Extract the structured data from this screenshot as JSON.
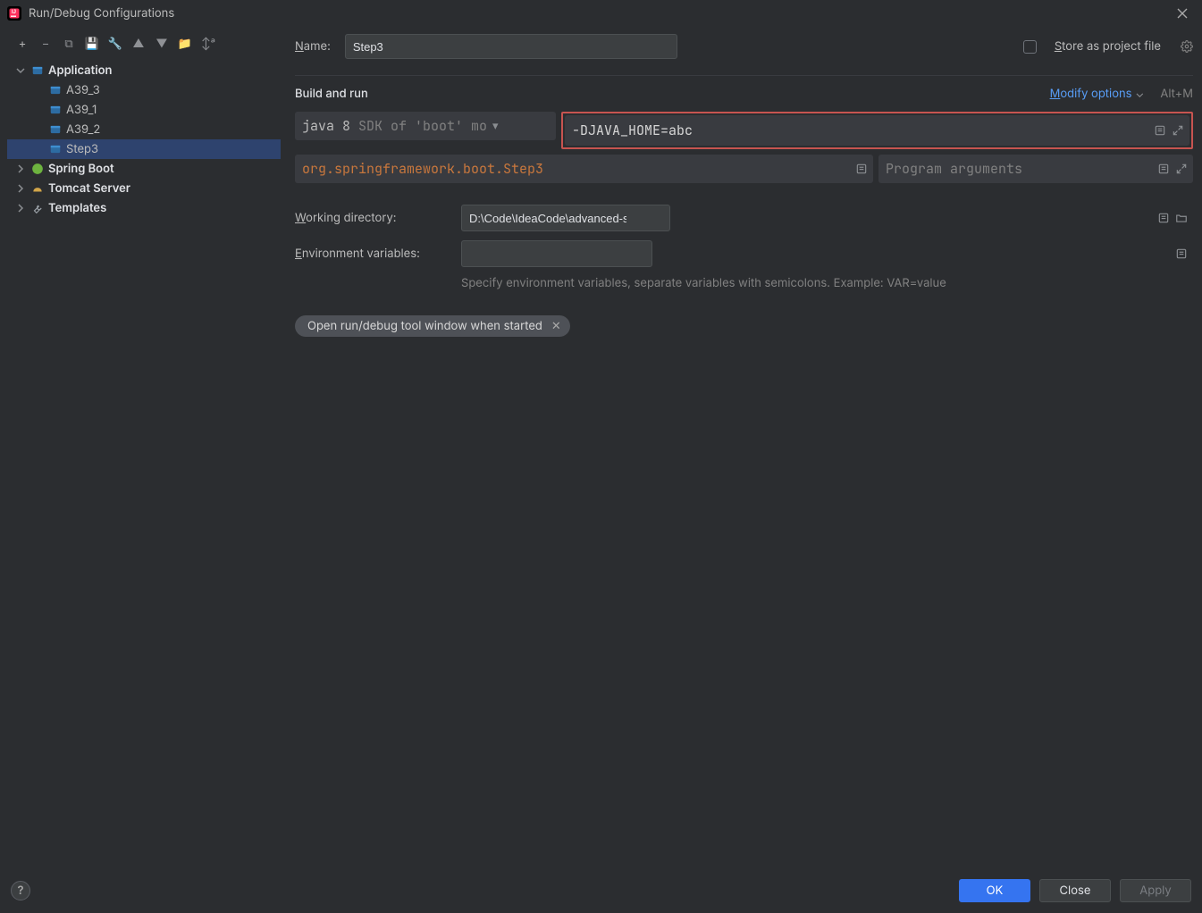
{
  "title": "Run/Debug Configurations",
  "toolbar_icons": [
    {
      "name": "add-icon",
      "glyph": "+"
    },
    {
      "name": "remove-icon",
      "glyph": "−"
    },
    {
      "name": "copy-icon",
      "glyph": "⧉"
    },
    {
      "name": "save-icon",
      "glyph": "💾"
    },
    {
      "name": "wrench-icon",
      "glyph": "🔧"
    },
    {
      "name": "move-up-icon",
      "glyph": "▲"
    },
    {
      "name": "move-down-icon",
      "glyph": "▼"
    },
    {
      "name": "folder-plus-icon",
      "glyph": "📁"
    },
    {
      "name": "sort-alpha-icon",
      "glyph": "↕ᵃ"
    }
  ],
  "tree": [
    {
      "label": "Application",
      "expanded": true,
      "depth": 0,
      "children": true,
      "selected": false,
      "icon": "terminal-icon"
    },
    {
      "label": "A39_3",
      "depth": 1,
      "children": false,
      "selected": false,
      "icon": "terminal-icon"
    },
    {
      "label": "A39_1",
      "depth": 1,
      "children": false,
      "selected": false,
      "icon": "terminal-icon"
    },
    {
      "label": "A39_2",
      "depth": 1,
      "children": false,
      "selected": false,
      "icon": "terminal-icon"
    },
    {
      "label": "Step3",
      "depth": 1,
      "children": false,
      "selected": true,
      "icon": "terminal-icon"
    },
    {
      "label": "Spring Boot",
      "expanded": false,
      "depth": 0,
      "children": true,
      "selected": false,
      "icon": "spring-icon"
    },
    {
      "label": "Tomcat Server",
      "expanded": false,
      "depth": 0,
      "children": true,
      "selected": false,
      "icon": "tomcat-icon"
    },
    {
      "label": "Templates",
      "expanded": false,
      "depth": 0,
      "children": true,
      "selected": false,
      "icon": "wrench-icon"
    }
  ],
  "form": {
    "name_label": "Name:",
    "name_value": "Step3",
    "store_label": "Store as project file",
    "section_title": "Build and run",
    "modify_options_label": "Modify options",
    "modify_options_shortcut": "Alt+M",
    "sdk_text_prefix": "java 8",
    "sdk_text_dim": " SDK of 'boot' mo",
    "vm_options_value": "-DJAVA_HOME=abc",
    "main_class_value": "org.springframework.boot.Step3",
    "program_args_placeholder": "Program arguments",
    "workdir_label": "Working directory:",
    "workdir_value": "D:\\Code\\IdeaCode\\advanced-spring",
    "envvars_label": "Environment variables:",
    "envvars_value": "",
    "envvars_hint": "Specify environment variables, separate variables with semicolons. Example: VAR=value",
    "chip_label": "Open run/debug tool window when started"
  },
  "buttons": {
    "ok": "OK",
    "close": "Close",
    "apply": "Apply"
  }
}
